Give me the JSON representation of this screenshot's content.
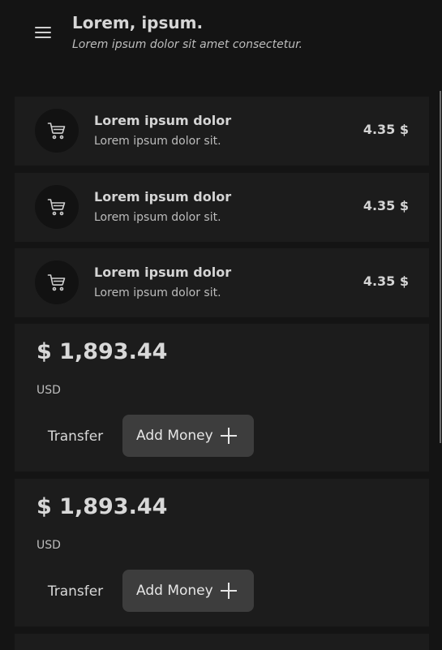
{
  "header": {
    "menu_icon": "hamburger-menu-icon",
    "title": "Lorem, ipsum.",
    "subtitle": "Lorem ipsum dolor sit amet consectetur."
  },
  "transactions": [
    {
      "icon": "cart-icon",
      "name": "Lorem ipsum dolor",
      "description": "Lorem ipsum dolor sit.",
      "amount": "4.35 $"
    },
    {
      "icon": "cart-icon",
      "name": "Lorem ipsum dolor",
      "description": "Lorem ipsum dolor sit.",
      "amount": "4.35 $"
    },
    {
      "icon": "cart-icon",
      "name": "Lorem ipsum dolor",
      "description": "Lorem ipsum dolor sit.",
      "amount": "4.35 $"
    }
  ],
  "balance_cards": [
    {
      "amount": "$ 1,893.44",
      "currency": "USD",
      "transfer_label": "Transfer",
      "add_money_label": "Add Money",
      "add_icon": "plus-icon"
    },
    {
      "amount": "$ 1,893.44",
      "currency": "USD",
      "transfer_label": "Transfer",
      "add_money_label": "Add Money",
      "add_icon": "plus-icon"
    }
  ],
  "colors": {
    "background": "#141414",
    "card": "#1c1c1c",
    "button": "#3d3d3d",
    "text": "#d4d4d4"
  }
}
